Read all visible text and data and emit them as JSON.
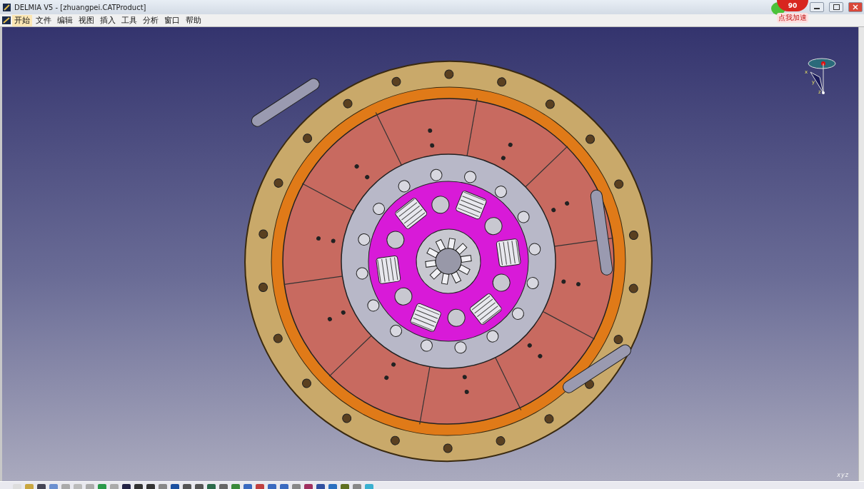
{
  "window": {
    "title": "DELMIA V5 - [zhuangpei.CATProduct]"
  },
  "menu": [
    {
      "label": "开始",
      "selected": true
    },
    {
      "label": "文件",
      "selected": false
    },
    {
      "label": "编辑",
      "selected": false
    },
    {
      "label": "视图",
      "selected": false
    },
    {
      "label": "插入",
      "selected": false
    },
    {
      "label": "工具",
      "selected": false
    },
    {
      "label": "分析",
      "selected": false
    },
    {
      "label": "窗口",
      "selected": false
    },
    {
      "label": "帮助",
      "selected": false
    }
  ],
  "speed_widget": {
    "value": "90",
    "label": "点我加速"
  },
  "compass": {
    "axes": [
      "x",
      "y",
      "z"
    ]
  },
  "corner_axes": [
    "x",
    "y",
    "z"
  ]
}
